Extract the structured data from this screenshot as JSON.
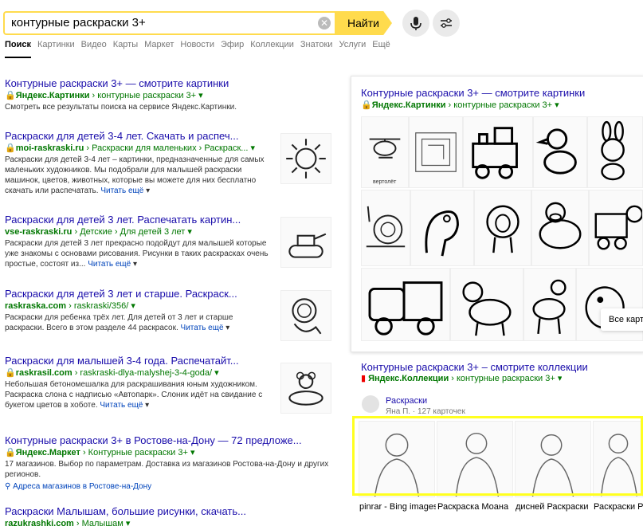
{
  "search": {
    "query": "контурные раскраски 3+",
    "button": "Найти"
  },
  "tabs": [
    "Поиск",
    "Картинки",
    "Видео",
    "Карты",
    "Маркет",
    "Новости",
    "Эфир",
    "Коллекции",
    "Знатоки",
    "Услуги",
    "Ещё"
  ],
  "results": [
    {
      "title": "Контурные раскраски 3+ — смотрите картинки",
      "url_host": "Яндекс.Картинки",
      "url_path": "контурные раскраски 3+",
      "snippet": "Смотреть все результаты поиска на сервисе Яндекс.Картинки."
    },
    {
      "title": "Раскраски для детей 3-4 лет. Скачать и распеч...",
      "url_host": "moi-raskraski.ru",
      "url_path": "Раскраски для маленьких › Раскраск...",
      "snippet": "Раскраски для детей 3-4 лет – картинки, предназначенные для самых маленьких художников. Мы подобрали для малышей раскраски машинок, цветов, животных, которые вы можете для них бесплатно скачать или распечатать.",
      "more": "Читать ещё"
    },
    {
      "title": "Раскраски для детей 3 лет. Распечатать картин...",
      "url_host": "vse-raskraski.ru",
      "url_path": "Детские › Для детей 3 лет",
      "snippet": "Раскраски для детей 3 лет прекрасно подойдут для малышей которые уже знакомы с основами рисования. Рисунки в таких раскрасках очень простые, состоят из...",
      "more": "Читать ещё"
    },
    {
      "title": "Раскраски для детей 3 лет и старше. Раскраск...",
      "url_host": "raskraska.com",
      "url_path": "raskraski/356/",
      "snippet": "Раскраски для ребенка трёх лет. Для детей от 3 лет и старше раскраски. Всего в этом разделе 44 раскрасок.",
      "more": "Читать ещё"
    },
    {
      "title": "Раскраски для малышей 3-4 года. Распечатайт...",
      "url_host": "raskrasil.com",
      "url_path": "raskraski-dlya-malyshej-3-4-goda/",
      "snippet": "Небольшая бетономешалка для раскрашивания юным художником. Раскраска слона с надписью «Автопарк». Слоник идёт на свидание с букетом цветов в хоботе.",
      "more": "Читать ещё"
    },
    {
      "title": "Контурные раскраски 3+ в Ростове-на-Дону — 72 предложе...",
      "url_host": "Яндекс.Маркет",
      "url_path": "Контурные раскраски 3+",
      "snippet": "17 магазинов. Выбор по параметрам. Доставка из магазинов Ростова-на-Дону и других регионов.",
      "address": "Адреса магазинов в Ростове-на-Дону"
    },
    {
      "title": "Раскраски Малышам, большие рисунки, скачать...",
      "url_host": "razukrashki.com",
      "url_path": "Малышам"
    }
  ],
  "panel": {
    "title": "Контурные раскраски 3+ — смотрите картинки",
    "url_host": "Яндекс.Картинки",
    "url_path": "контурные раскраски 3+",
    "all_button": "Все картинки",
    "img_label": "вертолёт"
  },
  "collections": {
    "title": "Контурные раскраски 3+ – смотрите коллекции",
    "url_host": "Яндекс.Коллекции",
    "url_path": "контурные раскраски 3+",
    "board": "Раскраски",
    "author": "Яна П.",
    "cards": "127 карточек",
    "captions": [
      "pinrar - Bing images",
      "Раскраска Моана",
      "дисней Раскраски",
      "Раскраски Рапунцель..."
    ]
  },
  "colors": {
    "accent": "#ffdb4d",
    "link": "#1a0dab",
    "url": "#007700",
    "highlight": "#ffff20"
  }
}
